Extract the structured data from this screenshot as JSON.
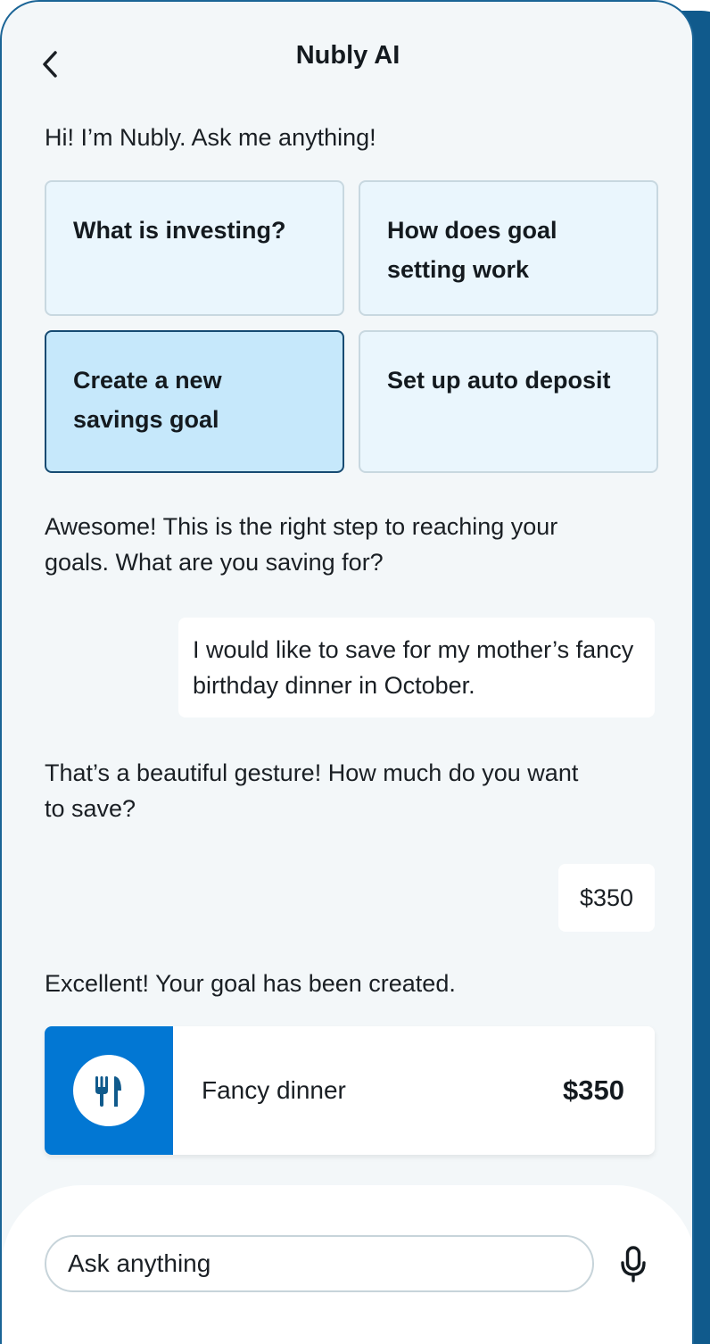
{
  "header": {
    "title": "Nubly AI",
    "back_icon": "chevron-left-icon"
  },
  "chat": {
    "greeting": "Hi! I’m Nubly. Ask me anything!",
    "suggestions": [
      {
        "label": "What is investing?",
        "selected": false
      },
      {
        "label": "How does goal setting work",
        "selected": false
      },
      {
        "label": "Create a new savings goal",
        "selected": true
      },
      {
        "label": "Set up auto deposit",
        "selected": false
      }
    ],
    "messages": [
      {
        "from": "bot",
        "text": "Awesome! This is the right step to reaching your goals. What are you saving for?"
      },
      {
        "from": "user",
        "text": "I would like to save for my mother’s fancy birthday dinner in October."
      },
      {
        "from": "bot",
        "text": "That’s a beautiful gesture! How much do you want to save?"
      },
      {
        "from": "user",
        "text": "$350"
      },
      {
        "from": "bot",
        "text": "Excellent! Your goal has been created."
      }
    ],
    "goal_card": {
      "icon": "utensils-icon",
      "name": "Fancy dinner",
      "amount": "$350"
    }
  },
  "composer": {
    "placeholder": "Ask anything",
    "mic_icon": "microphone-icon"
  },
  "colors": {
    "accent": "#0277d3",
    "selected_card_bg": "#c6e8fb",
    "selected_card_border": "#164b72",
    "card_bg": "#eaf6fd",
    "page_bg": "#f3f7f9",
    "frame_shadow": "#105a8c"
  }
}
